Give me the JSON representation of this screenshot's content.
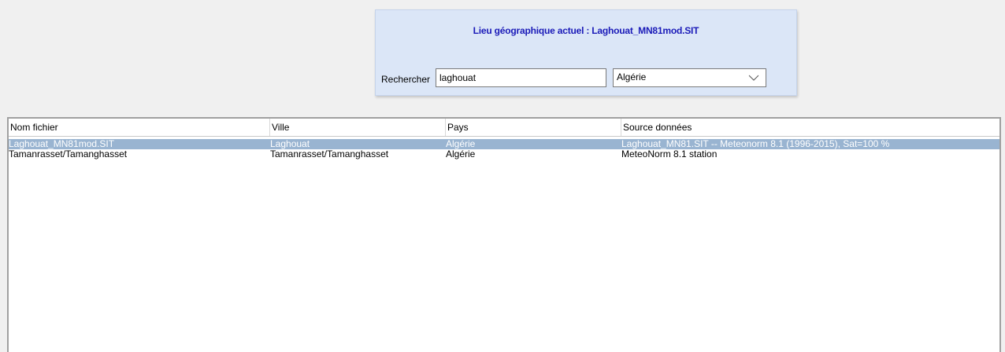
{
  "panel": {
    "title": "Lieu géographique actuel : Laghouat_MN81mod.SIT",
    "search_label": "Rechercher",
    "search_value": "laghouat",
    "country_value": "Algérie",
    "title_color": "#1a1ab8",
    "background_color": "#dbe6f7"
  },
  "table": {
    "columns": [
      "Nom fichier",
      "Ville",
      "Pays",
      "Source données"
    ],
    "rows": [
      {
        "file": "Laghouat_MN81mod.SIT",
        "city": "Laghouat",
        "country": "Algérie",
        "source": "Laghouat_MN81.SIT -- Meteonorm 8.1 (1996-2015), Sat=100 %",
        "selected": true
      },
      {
        "file": "Tamanrasset/Tamanghasset",
        "city": "Tamanrasset/Tamanghasset",
        "country": "Algérie",
        "source": "MeteoNorm 8.1 station",
        "selected": false
      }
    ],
    "selection_color": "#99b4d1"
  }
}
